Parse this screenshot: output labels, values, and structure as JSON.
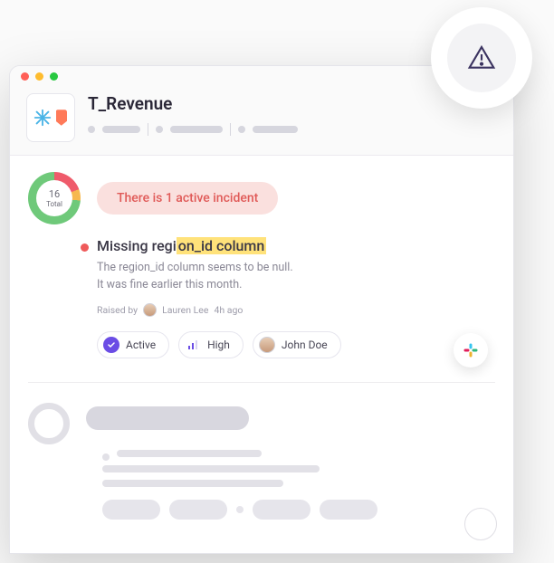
{
  "header": {
    "title": "T_Revenue"
  },
  "donut": {
    "total_label": "Total",
    "total_value": "16"
  },
  "banner": {
    "text": "There is 1 active incident"
  },
  "incident": {
    "title_pre": "Missing regi",
    "title_hl": "on_id column",
    "desc_line1": "The region_id column seems to be null.",
    "desc_line2": "It was fine earlier this month.",
    "raised_prefix": "Raised by",
    "raised_by": "Lauren Lee",
    "raised_time": "4h ago",
    "chips": {
      "status": "Active",
      "priority": "High",
      "assignee": "John Doe"
    }
  }
}
